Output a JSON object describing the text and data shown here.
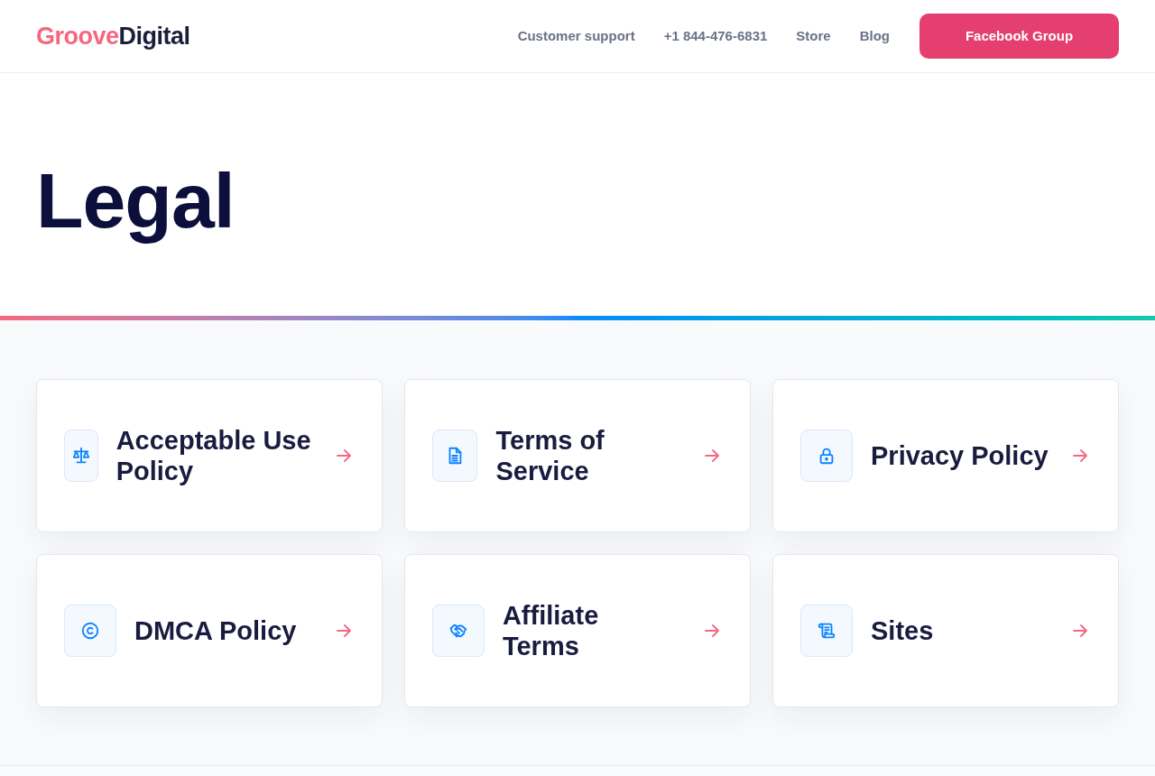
{
  "header": {
    "logo": {
      "accent": "Groove",
      "rest": "Digital"
    },
    "nav_links": [
      "Customer support",
      "+1 844-476-6831",
      "Store",
      "Blog"
    ],
    "cta_button": "Facebook Group"
  },
  "page_title": "Legal",
  "cards": [
    {
      "title": "Acceptable Use Policy"
    },
    {
      "title": "Terms of Service"
    },
    {
      "title": "Privacy Policy"
    },
    {
      "title": "DMCA Policy"
    },
    {
      "title": "Affiliate Terms"
    },
    {
      "title": "Sites"
    }
  ]
}
